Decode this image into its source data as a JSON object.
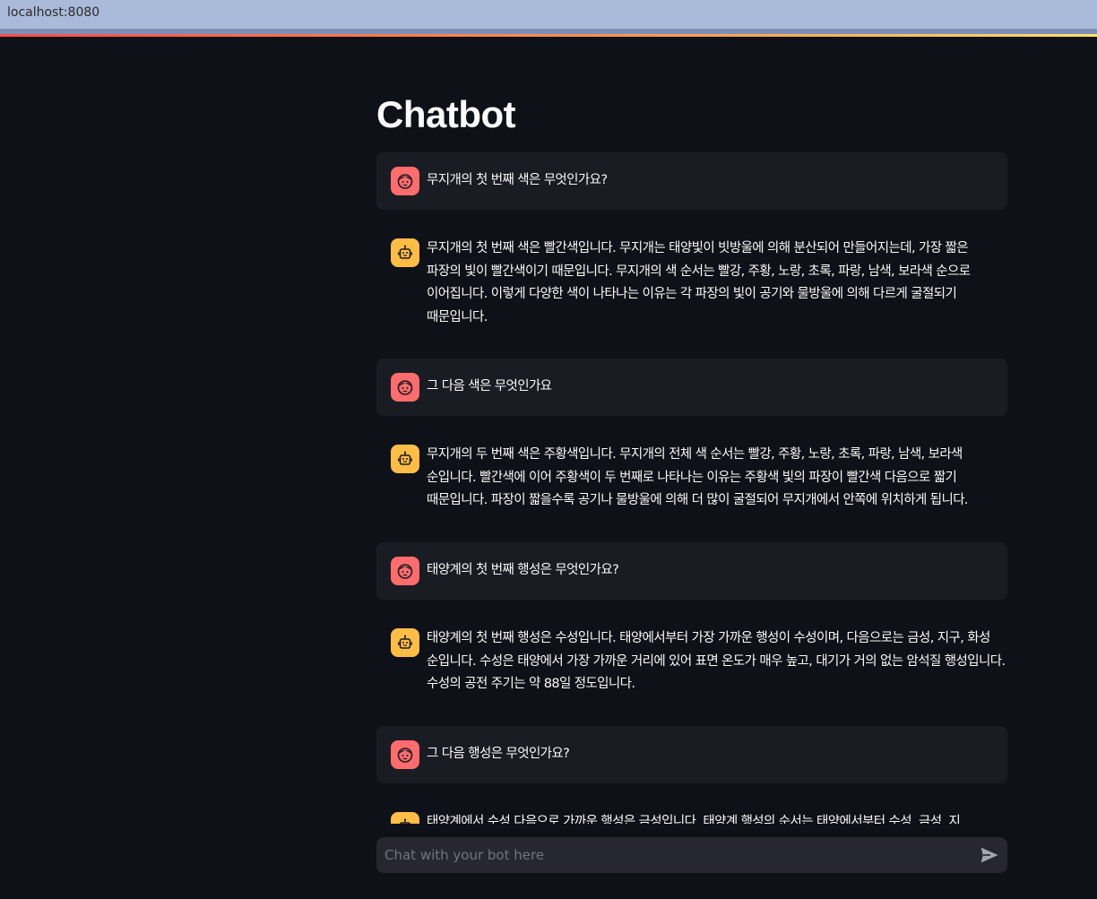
{
  "browser": {
    "url": "localhost:8080"
  },
  "page": {
    "title": "Chatbot"
  },
  "messages": [
    {
      "role": "user",
      "avatar": "user-avatar-icon",
      "text": "무지개의 첫 번째 색은 무엇인가요?"
    },
    {
      "role": "assistant",
      "avatar": "bot-avatar-icon",
      "text": "무지개의 첫 번째 색은 빨간색입니다. 무지개는 태양빛이 빗방울에 의해 분산되어 만들어지는데, 가장 짧은 파장의 빛이 빨간색이기 때문입니다. 무지개의 색 순서는 빨강, 주황, 노랑, 초록, 파랑, 남색, 보라색 순으로 이어집니다. 이렇게 다양한 색이 나타나는 이유는 각 파장의 빛이 공기와 물방울에 의해 다르게 굴절되기 때문입니다."
    },
    {
      "role": "user",
      "avatar": "user-avatar-icon",
      "text": "그 다음 색은 무엇인가요"
    },
    {
      "role": "assistant",
      "avatar": "bot-avatar-icon",
      "text": "무지개의 두 번째 색은 주황색입니다. 무지개의 전체 색 순서는 빨강, 주황, 노랑, 초록, 파랑, 남색, 보라색 순입니다. 빨간색에 이어 주황색이 두 번째로 나타나는 이유는 주황색 빛의 파장이 빨간색 다음으로 짧기 때문입니다. 파장이 짧을수록 공기나 물방울에 의해 더 많이 굴절되어 무지개에서 안쪽에 위치하게 됩니다."
    },
    {
      "role": "user",
      "avatar": "user-avatar-icon",
      "text": "태양계의 첫 번째 행성은 무엇인가요?"
    },
    {
      "role": "assistant",
      "avatar": "bot-avatar-icon",
      "text": "태양계의 첫 번째 행성은 수성입니다. 태양에서부터 가장 가까운 행성이 수성이며, 다음으로는 금성, 지구, 화성 순입니다. 수성은 태양에서 가장 가까운 거리에 있어 표면 온도가 매우 높고, 대기가 거의 없는 암석질 행성입니다. 수성의 공전 주기는 약 88일 정도입니다."
    },
    {
      "role": "user",
      "avatar": "user-avatar-icon",
      "text": "그 다음 행성은 무엇인가요?"
    },
    {
      "role": "assistant",
      "avatar": "bot-avatar-icon",
      "text": "태양계에서 수성 다음으로 가까운 행성은 금성입니다. 태양계 행성의 순서는 태양에서부터 수성, 금성, 지"
    }
  ],
  "chat_input": {
    "placeholder": "Chat with your bot here",
    "value": ""
  },
  "colors": {
    "background": "#0e1117",
    "user_message_bg": "#1a1c24",
    "user_avatar": "#ff6c6c",
    "bot_avatar": "#ffbd45",
    "input_bg": "#262730"
  }
}
